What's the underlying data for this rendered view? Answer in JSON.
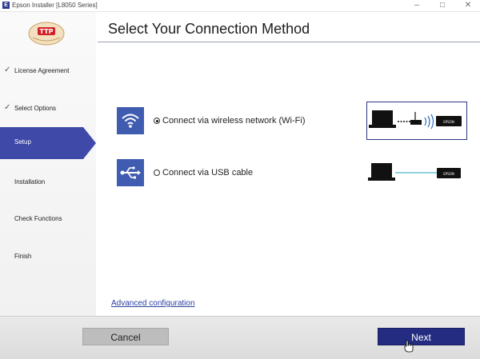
{
  "window": {
    "title": "Epson Installer [L8050 Series]",
    "app_icon": "E",
    "min": "–",
    "max": "□",
    "close": "✕"
  },
  "logo": {
    "text": "TTP"
  },
  "steps": [
    {
      "label": "License Agreement",
      "state": "done"
    },
    {
      "label": "Select Options",
      "state": "done"
    },
    {
      "label": "Setup",
      "state": "active"
    },
    {
      "label": "Installation",
      "state": "pending"
    },
    {
      "label": "Check Functions",
      "state": "pending"
    },
    {
      "label": "Finish",
      "state": "pending"
    }
  ],
  "check_mark": "✓",
  "page_title": "Select Your Connection Method",
  "options": [
    {
      "label": "Connect via wireless network (Wi-Fi)",
      "selected": true,
      "icon": "wifi-icon",
      "device_label": "EPSON"
    },
    {
      "label": "Connect via USB cable",
      "selected": false,
      "icon": "usb-icon",
      "device_label": "EPSON"
    }
  ],
  "advanced_link": "Advanced configuration",
  "buttons": {
    "cancel": "Cancel",
    "next": "Next"
  },
  "colors": {
    "accent": "#3f4aa8",
    "next_button": "#232c80",
    "icon_bg": "#3f5cb0",
    "usb_line": "#4ab9d6"
  }
}
